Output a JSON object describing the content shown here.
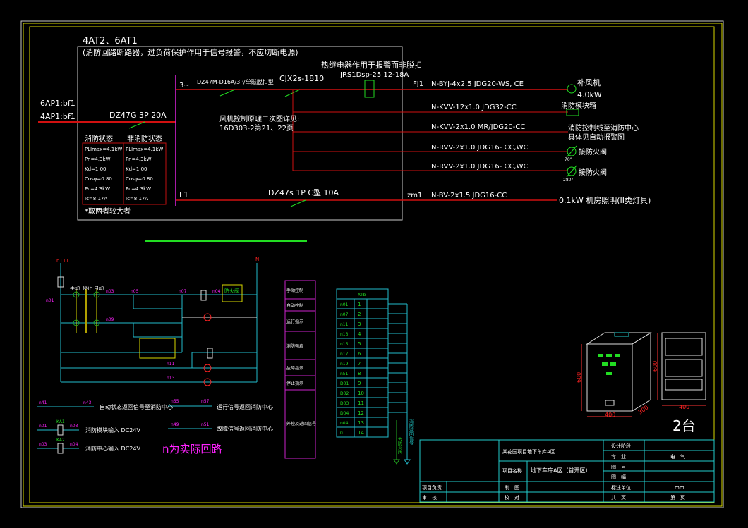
{
  "colors": {
    "background": "#000000",
    "frame": "#d8d800",
    "power_line": "#d01010",
    "control_line": "#22bbcc",
    "device": "#22dd22",
    "label": "#ff22ff"
  },
  "main": {
    "header1": "4AT2、6AT1",
    "header2": "(消防回路断路器，过负荷保护作用于信号报警，不应切断电源)",
    "thermal_note": "热继电器作用于报警而非脱扣",
    "thermal_model": "JRS1Dsp-25 12-18A",
    "inputs": [
      "6AP1:bf1",
      "4AP1:bf1"
    ],
    "main_breaker": "DZ47G 3P 20A",
    "phase": "3~",
    "motor_breaker": "DZ47M-D16A/3P/单磁脱扣型",
    "contactor": "CJX2s-1810",
    "control_note1": "风机控制原理二次图详见:",
    "control_note2": "16D303-2第21、22页",
    "l1": "L1",
    "lighting_breaker": "DZ47s 1P C型 10A",
    "table_headers": [
      "消防状态",
      "非消防状态"
    ],
    "table_fire": [
      "PLlmax=4.1kW",
      "Pn=4.3kW",
      "Kd=1.00",
      "Cosφ=0.80",
      "Pc=4.3kW",
      "Ic=8.17A"
    ],
    "table_nonfire": [
      "PLlmax=4.1kW",
      "Pn=4.3kW",
      "Kd=1.00",
      "Cosφ=0.80",
      "Pc=4.3kW",
      "Ic=8.17A"
    ],
    "table_note": "*取两者较大者",
    "circuits": [
      {
        "id": "FJ1",
        "cable": "N-BYJ-4x2.5 JDG20-WS, CE",
        "load": "补风机",
        "power": "4.0kW"
      },
      {
        "id": "",
        "cable": "N-KVV-12x1.0 JDG32-CC",
        "load": "消防模块箱"
      },
      {
        "id": "",
        "cable": "N-KVV-2x1.0 MR/JDG20-CC",
        "load": "消防控制线至消防中心",
        "load2": "具体见自动报警图"
      },
      {
        "id": "",
        "cable": "N-RVV-2x1.0 JDG16- CC,WC",
        "load": "接防火阀",
        "tag": "70°"
      },
      {
        "id": "",
        "cable": "N-RVV-2x1.0 JDG16- CC,WC",
        "load": "接防火阀",
        "tag": "280°"
      },
      {
        "id": "zm1",
        "cable": "N-BV-2x1.5 JDG16-CC",
        "load": "0.1kW   机房照明(II类灯具)"
      }
    ]
  },
  "control": {
    "top_left": "n111",
    "top_right": "N",
    "switch_labels": [
      "手动",
      "停止",
      "自动"
    ],
    "damper": "防火阀",
    "nodes": [
      "n01",
      "n03",
      "n05",
      "n07",
      "n09",
      "n11",
      "n13",
      "n04",
      "n02"
    ],
    "devices": [
      "FU",
      "SA",
      "SS",
      "KM",
      "KH",
      "SF",
      "KA1",
      "KA2",
      "HR",
      "HG",
      "HY",
      "KT"
    ],
    "note": "n为实际回路"
  },
  "legend": [
    {
      "left": "n41",
      "right": "n43",
      "text": "自动状态返回信号至消防中心"
    },
    {
      "left": "n55",
      "right": "n57",
      "text": "运行信号返回消防中心"
    },
    {
      "left": "n01",
      "right": "n03",
      "device": "KA1",
      "text": "消防模块输入 DC24V"
    },
    {
      "left": "n49",
      "right": "n51",
      "text": "故障信号返回消防中心"
    },
    {
      "left": "n03",
      "right": "n04",
      "device": "KA2",
      "text": "消防中心输入 DC24V"
    }
  ],
  "func_labels": [
    "手动控制",
    "自动控制",
    "运行指示",
    "消防强启",
    "故障指示",
    "停止指示",
    "外控及返回信号"
  ],
  "terminal": {
    "title": "XTb",
    "rows": [
      [
        "n01",
        "1"
      ],
      [
        "n07",
        "2"
      ],
      [
        "n11",
        "3"
      ],
      [
        "n13",
        "4"
      ],
      [
        "n15",
        "5"
      ],
      [
        "n17",
        "6"
      ],
      [
        "n19",
        "7"
      ],
      [
        "n51",
        "8"
      ],
      [
        "D01",
        "9"
      ],
      [
        "D02",
        "10"
      ],
      [
        "D03",
        "11"
      ],
      [
        "D04",
        "12"
      ],
      [
        "n04",
        "13"
      ],
      [
        "0",
        "14"
      ]
    ],
    "to_damper": "去防火阀",
    "return_signal": "消防返回信号"
  },
  "cabinet": {
    "height": "600",
    "width": "400",
    "depth": "300",
    "panel_height": "600",
    "panel_width": "400",
    "qty": "2台"
  },
  "titleblock": {
    "project": "某花园项目地下车库A区",
    "project_name_label": "项目名称",
    "project_name": "地下车库A区（首开区）",
    "stage_label": "设计阶段",
    "discipline_label": "专　业",
    "discipline": "电　气",
    "drawing_no_label": "图　号",
    "size_label": "图　幅",
    "leader_label": "项目负责",
    "review_label": "审　核",
    "draw_label": "制　图",
    "check_label": "校　对",
    "unit_label": "标注单位",
    "unit": "mm",
    "total_label": "共　页",
    "page_label": "第　页"
  }
}
